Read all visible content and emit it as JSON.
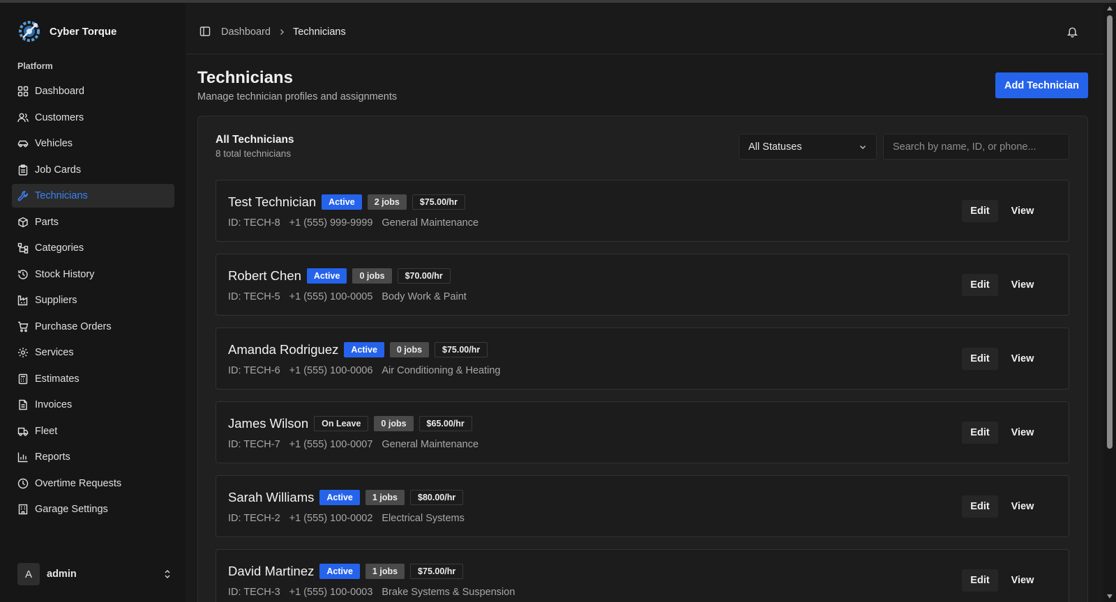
{
  "app": {
    "name": "Cyber Torque"
  },
  "sidebar": {
    "section_label": "Platform",
    "items": [
      {
        "label": "Dashboard",
        "icon": "grid-icon"
      },
      {
        "label": "Customers",
        "icon": "users-icon"
      },
      {
        "label": "Vehicles",
        "icon": "car-icon"
      },
      {
        "label": "Job Cards",
        "icon": "clipboard-icon"
      },
      {
        "label": "Technicians",
        "icon": "wrench-icon",
        "active": true
      },
      {
        "label": "Parts",
        "icon": "package-icon"
      },
      {
        "label": "Categories",
        "icon": "hierarchy-icon"
      },
      {
        "label": "Stock History",
        "icon": "history-icon"
      },
      {
        "label": "Suppliers",
        "icon": "factory-icon"
      },
      {
        "label": "Purchase Orders",
        "icon": "cart-icon"
      },
      {
        "label": "Services",
        "icon": "gear-icon"
      },
      {
        "label": "Estimates",
        "icon": "calculator-icon"
      },
      {
        "label": "Invoices",
        "icon": "receipt-icon"
      },
      {
        "label": "Fleet",
        "icon": "truck-icon"
      },
      {
        "label": "Reports",
        "icon": "bar-chart-icon"
      },
      {
        "label": "Overtime Requests",
        "icon": "clock-icon"
      },
      {
        "label": "Garage Settings",
        "icon": "building-icon"
      }
    ],
    "user": {
      "initial": "A",
      "name": "admin"
    }
  },
  "header": {
    "breadcrumb": [
      "Dashboard",
      "Technicians"
    ]
  },
  "page": {
    "title": "Technicians",
    "subtitle": "Manage technician profiles and assignments",
    "add_button": "Add Technician"
  },
  "list": {
    "title": "All Technicians",
    "subtitle": "8 total technicians",
    "status_filter": "All Statuses",
    "search_placeholder": "Search by name, ID, or phone...",
    "edit_label": "Edit",
    "view_label": "View",
    "technicians": [
      {
        "name": "Test Technician",
        "status": "Active",
        "jobs": "2 jobs",
        "rate": "$75.00/hr",
        "id": "ID: TECH-8",
        "phone": "+1 (555) 999-9999",
        "specialty": "General Maintenance"
      },
      {
        "name": "Robert Chen",
        "status": "Active",
        "jobs": "0 jobs",
        "rate": "$70.00/hr",
        "id": "ID: TECH-5",
        "phone": "+1 (555) 100-0005",
        "specialty": "Body Work & Paint"
      },
      {
        "name": "Amanda Rodriguez",
        "status": "Active",
        "jobs": "0 jobs",
        "rate": "$75.00/hr",
        "id": "ID: TECH-6",
        "phone": "+1 (555) 100-0006",
        "specialty": "Air Conditioning & Heating"
      },
      {
        "name": "James Wilson",
        "status": "On Leave",
        "jobs": "0 jobs",
        "rate": "$65.00/hr",
        "id": "ID: TECH-7",
        "phone": "+1 (555) 100-0007",
        "specialty": "General Maintenance"
      },
      {
        "name": "Sarah Williams",
        "status": "Active",
        "jobs": "1 jobs",
        "rate": "$80.00/hr",
        "id": "ID: TECH-2",
        "phone": "+1 (555) 100-0002",
        "specialty": "Electrical Systems"
      },
      {
        "name": "David Martinez",
        "status": "Active",
        "jobs": "1 jobs",
        "rate": "$75.00/hr",
        "id": "ID: TECH-3",
        "phone": "+1 (555) 100-0003",
        "specialty": "Brake Systems & Suspension"
      }
    ]
  },
  "colors": {
    "accent": "#2563eb",
    "active_nav": "#3b82f6",
    "background": "#1a1a1a"
  }
}
